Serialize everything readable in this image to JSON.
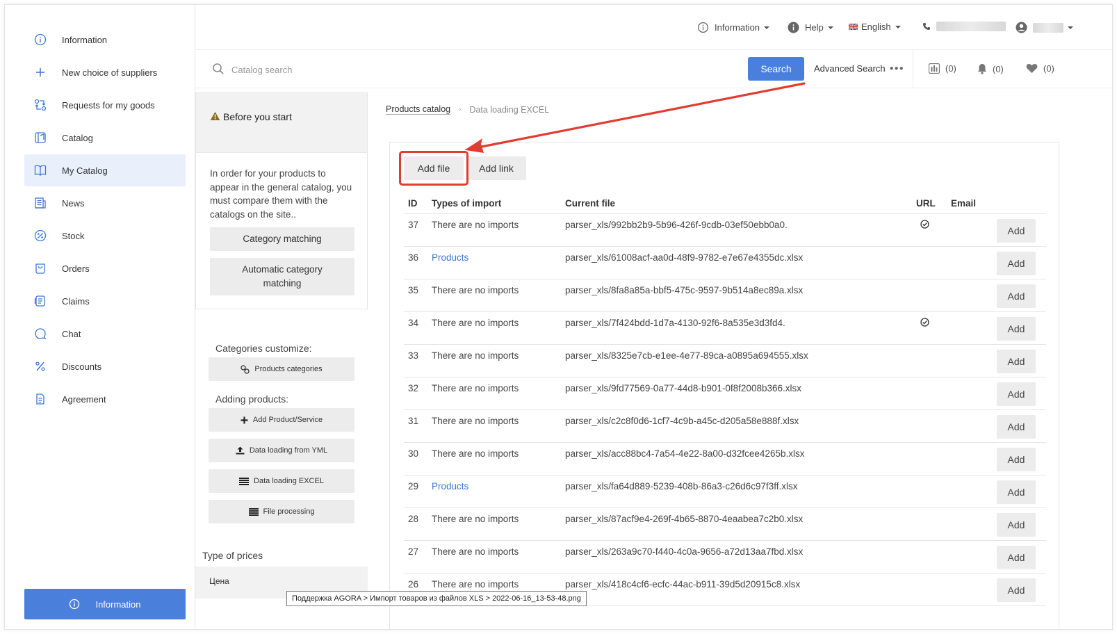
{
  "sidebar": {
    "items": [
      {
        "label": "Information",
        "icon": "info-icon"
      },
      {
        "label": "New choice of suppliers",
        "icon": "plus-icon"
      },
      {
        "label": "Requests for my goods",
        "icon": "exchange-icon"
      },
      {
        "label": "Catalog",
        "icon": "catalog-icon"
      },
      {
        "label": "My Catalog",
        "icon": "book-icon",
        "active": true
      },
      {
        "label": "News",
        "icon": "news-icon"
      },
      {
        "label": "Stock",
        "icon": "stock-icon"
      },
      {
        "label": "Orders",
        "icon": "orders-icon"
      },
      {
        "label": "Claims",
        "icon": "claims-icon"
      },
      {
        "label": "Chat",
        "icon": "chat-icon"
      },
      {
        "label": "Discounts",
        "icon": "percent-icon"
      },
      {
        "label": "Agreement",
        "icon": "document-icon"
      }
    ],
    "bottom_button": "Information"
  },
  "topbar": {
    "information": "Information",
    "help": "Help",
    "language": "English"
  },
  "search": {
    "placeholder": "Catalog search",
    "button": "Search",
    "advanced": "Advanced Search",
    "counters": {
      "compare": "(0)",
      "notifications": "(0)",
      "favorites": "(0)"
    }
  },
  "left_panel": {
    "before_title": "Before you start",
    "before_text": "In order for your products to appear in the general catalog, you must compare them with the catalogs on the site..",
    "category_matching": "Category matching",
    "auto_category_matching": "Automatic category matching",
    "categories_customize": "Categories customize:",
    "products_categories": "Products categories",
    "adding_products": "Adding products:",
    "add_product": "Add Product/Service",
    "yml": "Data loading from YML",
    "excel": "Data loading EXCEL",
    "file_processing": "File processing",
    "type_of_prices": "Type of prices",
    "price_name": "Цена"
  },
  "breadcrumb": {
    "parent": "Products catalog",
    "current": "Data loading EXCEL"
  },
  "main": {
    "add_file": "Add file",
    "add_link": "Add link",
    "columns": {
      "id": "ID",
      "type": "Types of import",
      "file": "Current file",
      "url": "URL",
      "email": "Email"
    },
    "action_label": "Add",
    "rows": [
      {
        "id": "37",
        "type": "There are no imports",
        "file": "parser_xls/992bb2b9-5b96-426f-9cdb-03ef50ebb0a0.",
        "url": true
      },
      {
        "id": "36",
        "type": "Products",
        "link": true,
        "file": "parser_xls/61008acf-aa0d-48f9-9782-e7e67e4355dc.xlsx",
        "url": false
      },
      {
        "id": "35",
        "type": "There are no imports",
        "file": "parser_xls/8fa8a85a-bbf5-475c-9597-9b514a8ec89a.xlsx",
        "url": false
      },
      {
        "id": "34",
        "type": "There are no imports",
        "file": "parser_xls/7f424bdd-1d7a-4130-92f6-8a535e3d3fd4.",
        "url": true
      },
      {
        "id": "33",
        "type": "There are no imports",
        "file": "parser_xls/8325e7cb-e1ee-4e77-89ca-a0895a694555.xlsx",
        "url": false
      },
      {
        "id": "32",
        "type": "There are no imports",
        "file": "parser_xls/9fd77569-0a77-44d8-b901-0f8f2008b366.xlsx",
        "url": false
      },
      {
        "id": "31",
        "type": "There are no imports",
        "file": "parser_xls/c2c8f0d6-1cf7-4c9b-a45c-d205a58e888f.xlsx",
        "url": false
      },
      {
        "id": "30",
        "type": "There are no imports",
        "file": "parser_xls/acc88bc4-7a54-4e22-8a00-d32fcee4265b.xlsx",
        "url": false
      },
      {
        "id": "29",
        "type": "Products",
        "link": true,
        "file": "parser_xls/fa64d889-5239-408b-86a3-c26d6c97f3ff.xlsx",
        "url": false
      },
      {
        "id": "28",
        "type": "There are no imports",
        "file": "parser_xls/87acf9e4-269f-4b65-8870-4eaabea7c2b0.xlsx",
        "url": false
      },
      {
        "id": "27",
        "type": "There are no imports",
        "file": "parser_xls/263a9c70-f440-4c0a-9656-a72d13aa7fbd.xlsx",
        "url": false
      },
      {
        "id": "26",
        "type": "There are no imports",
        "file": "parser_xls/418c4cf6-ecfc-44ac-b911-39d5d20915c8.xlsx",
        "url": false
      }
    ]
  },
  "tooltip": "Поддержка AGORA > Импорт товаров из файлов XLS > 2022-06-16_13-53-48.png",
  "colors": {
    "accent": "#4a7fdb",
    "highlight": "#e23b30",
    "link": "#3d77d4"
  }
}
